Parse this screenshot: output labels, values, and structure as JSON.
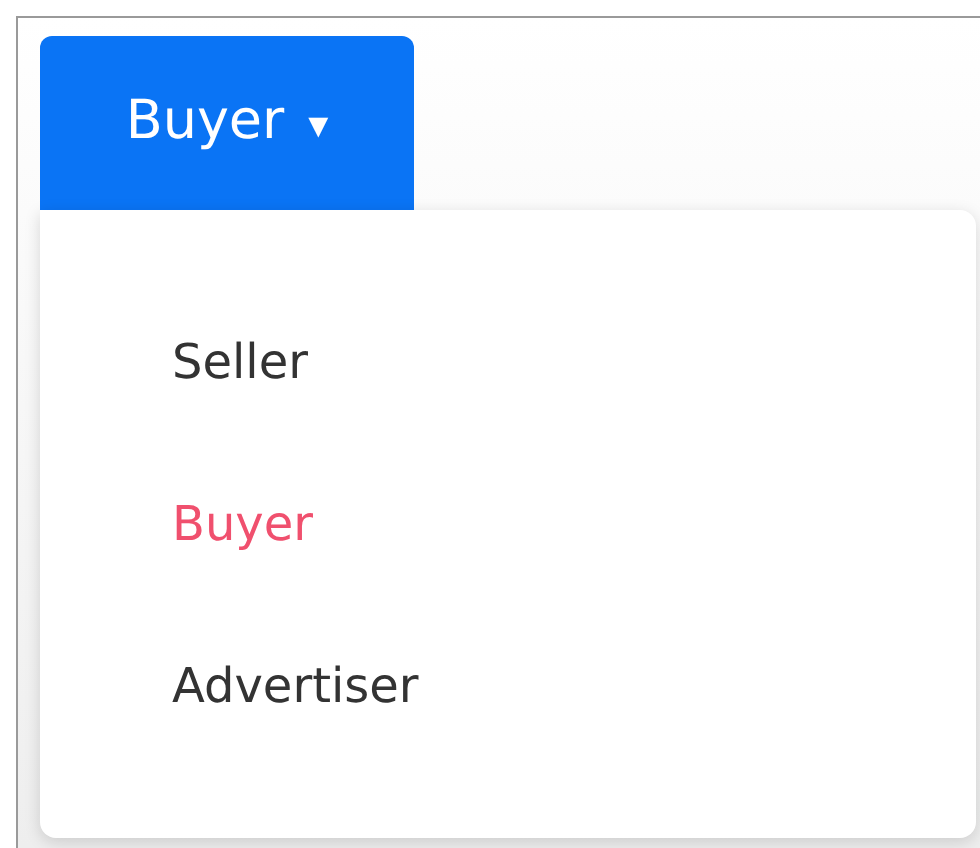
{
  "dropdown_button": {
    "label": "Buyer",
    "caret": "▾",
    "expanded": true
  },
  "menu_items": [
    {
      "label": "Seller",
      "selected": false
    },
    {
      "label": "Buyer",
      "selected": true
    },
    {
      "label": "Advertiser",
      "selected": false
    }
  ]
}
